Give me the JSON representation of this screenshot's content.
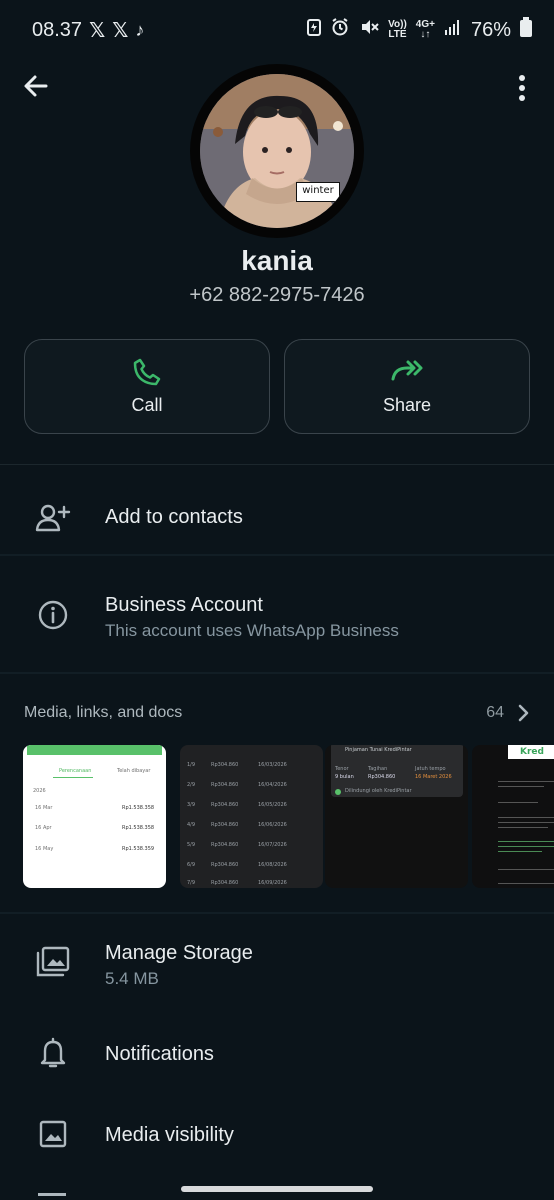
{
  "status": {
    "time": "08.37",
    "battery": "76%",
    "volte": "Vo))\nLTE",
    "network": "4G+"
  },
  "header": {
    "back_icon": "arrow-left-icon",
    "more_icon": "more-vert-icon"
  },
  "profile": {
    "name": "kania",
    "phone": "+62 882-2975-7426",
    "avatar_sticker": "winter"
  },
  "actions": {
    "call_label": "Call",
    "share_label": "Share"
  },
  "menu": {
    "add_contact": "Add to contacts",
    "business_title": "Business Account",
    "business_sub": "This account uses WhatsApp Business",
    "media_title": "Media, links, and docs",
    "media_count": "64",
    "manage_title": "Manage Storage",
    "manage_size": "5.4 MB",
    "notifications": "Notifications",
    "media_visibility": "Media visibility"
  },
  "thumbs": {
    "t1_tab_left": "Perencanaan",
    "t1_tab_right": "Telah dibayar",
    "t1_year": "2026",
    "t1_rows": [
      {
        "date": "16 Mar",
        "amount": "Rp1.538.358"
      },
      {
        "date": "16 Apr",
        "amount": "Rp1.538.358"
      },
      {
        "date": "16 May",
        "amount": "Rp1.538.359"
      }
    ],
    "t2_rows": [
      {
        "n": "1/9",
        "amount": "Rp304.860",
        "date": "16/03/2026"
      },
      {
        "n": "2/9",
        "amount": "Rp304.860",
        "date": "16/04/2026"
      },
      {
        "n": "3/9",
        "amount": "Rp304.860",
        "date": "16/05/2026"
      },
      {
        "n": "4/9",
        "amount": "Rp304.860",
        "date": "16/06/2026"
      },
      {
        "n": "5/9",
        "amount": "Rp304.860",
        "date": "16/07/2026"
      },
      {
        "n": "6/9",
        "amount": "Rp304.860",
        "date": "16/08/2026"
      },
      {
        "n": "7/9",
        "amount": "Rp304.860",
        "date": "16/09/2026"
      }
    ],
    "t3_title": "Pinjaman Tunai KrediPintar",
    "t3_col1": "Tenor",
    "t3_col2": "Tagihan",
    "t3_col3": "Jatuh tempo",
    "t3_v1": "9 bulan",
    "t3_v2": "Rp304.860",
    "t3_v3": "16 Maret 2026",
    "t3_footer": "Dilindungi oleh KrediPintar",
    "t4_brand": "Kred"
  },
  "colors": {
    "background": "#0b141a",
    "accent_green": "#3cb86a",
    "text_primary": "#e9edef",
    "text_secondary": "#8696a0"
  }
}
